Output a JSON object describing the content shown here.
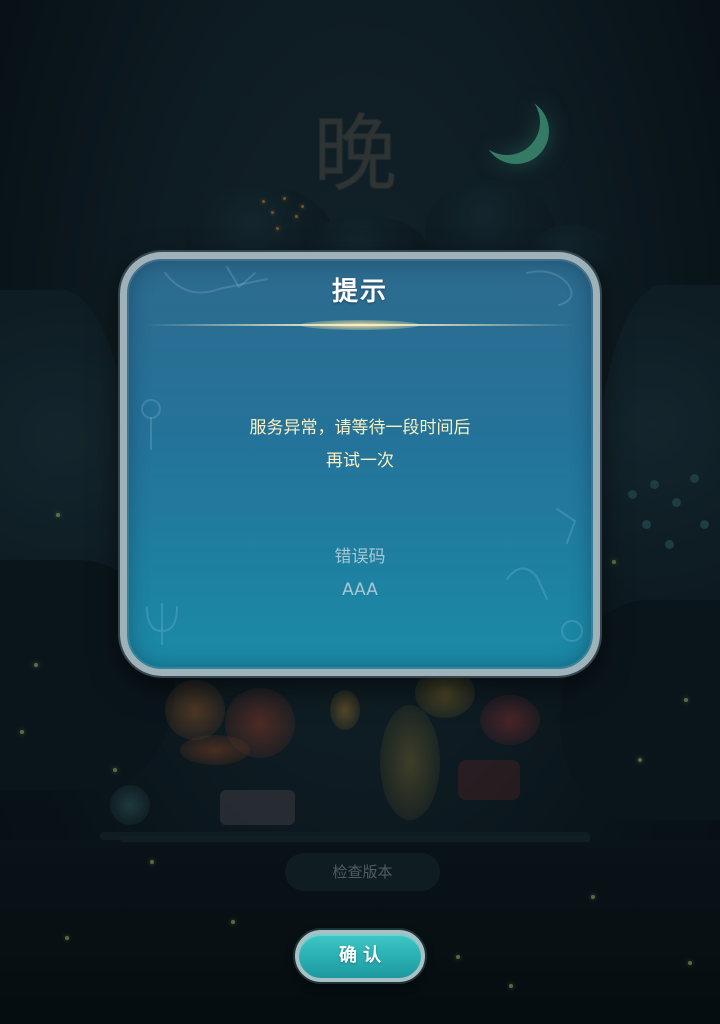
{
  "background": {
    "logo_text": "晚",
    "status": {
      "check_version_label": "检查版本"
    }
  },
  "dialog": {
    "title": "提示",
    "message_lines": [
      "服务异常，请等待一段时间后",
      "再试一次"
    ],
    "error_code_label": "错误码",
    "error_code": "AAA"
  },
  "actions": {
    "confirm_label": "确认"
  },
  "icons": {
    "moon": "crescent-moon-icon"
  },
  "colors": {
    "dialog_top": "#2d6a8e",
    "dialog_bottom": "#1a8ba7",
    "message_text": "#fcf1c2",
    "muted_text": "#a9c7d2",
    "confirm_button": "#29afb2"
  }
}
